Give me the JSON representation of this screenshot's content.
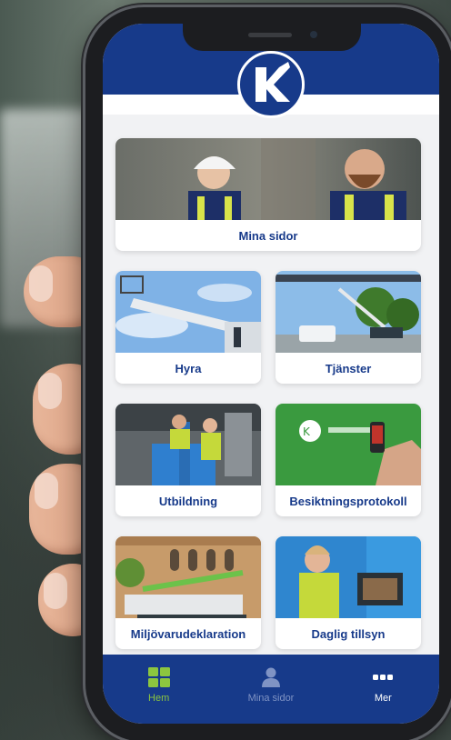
{
  "cards": [
    {
      "id": "mina-sidor",
      "label": "Mina sidor"
    },
    {
      "id": "hyra",
      "label": "Hyra"
    },
    {
      "id": "tjanster",
      "label": "Tjänster"
    },
    {
      "id": "utbildning",
      "label": "Utbildning"
    },
    {
      "id": "besiktningsprotokoll",
      "label": "Besiktningsprotokoll"
    },
    {
      "id": "miljovarudeklaration",
      "label": "Miljövarudeklaration"
    },
    {
      "id": "daglig-tillsyn",
      "label": "Daglig tillsyn"
    }
  ],
  "tabs": [
    {
      "label": "Hem",
      "icon": "grid-icon",
      "active": true
    },
    {
      "label": "Mina sidor",
      "icon": "person-icon",
      "active": false
    },
    {
      "label": "Mer",
      "icon": "dots-icon",
      "active": false
    }
  ],
  "logo": {
    "letter": "K"
  },
  "colors": {
    "brand": "#173a8a",
    "active_tab": "#8cc63f",
    "inactive_tab": "#7f93c4",
    "white": "#ffffff"
  }
}
